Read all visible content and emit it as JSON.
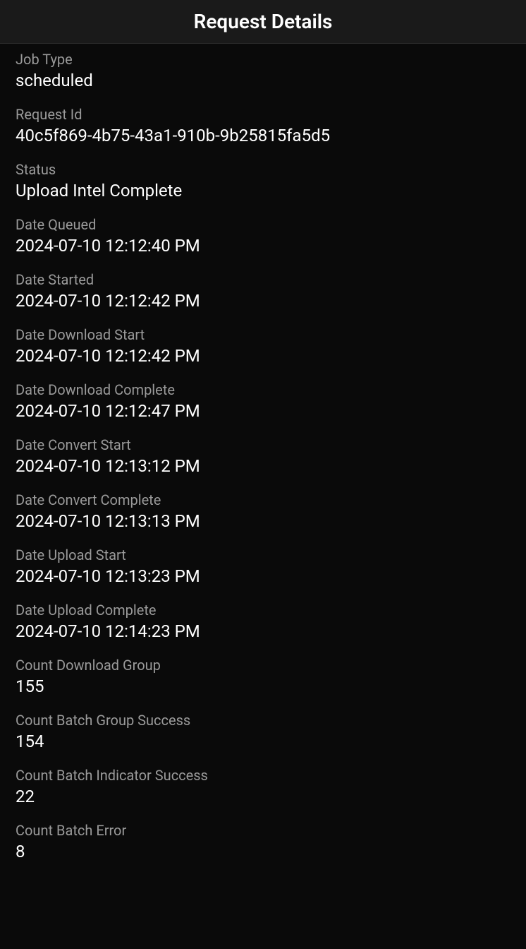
{
  "header": {
    "title": "Request Details"
  },
  "fields": [
    {
      "label": "Job Type",
      "value": "scheduled"
    },
    {
      "label": "Request Id",
      "value": "40c5f869-4b75-43a1-910b-9b25815fa5d5"
    },
    {
      "label": "Status",
      "value": "Upload Intel Complete"
    },
    {
      "label": "Date Queued",
      "value": "2024-07-10 12:12:40 PM"
    },
    {
      "label": "Date Started",
      "value": "2024-07-10 12:12:42 PM"
    },
    {
      "label": "Date Download Start",
      "value": "2024-07-10 12:12:42 PM"
    },
    {
      "label": "Date Download Complete",
      "value": "2024-07-10 12:12:47 PM"
    },
    {
      "label": "Date Convert Start",
      "value": "2024-07-10 12:13:12 PM"
    },
    {
      "label": "Date Convert Complete",
      "value": "2024-07-10 12:13:13 PM"
    },
    {
      "label": "Date Upload Start",
      "value": "2024-07-10 12:13:23 PM"
    },
    {
      "label": "Date Upload Complete",
      "value": "2024-07-10 12:14:23 PM"
    },
    {
      "label": "Count Download Group",
      "value": "155"
    },
    {
      "label": "Count Batch Group Success",
      "value": "154"
    },
    {
      "label": "Count Batch Indicator Success",
      "value": "22"
    },
    {
      "label": "Count Batch Error",
      "value": "8"
    }
  ]
}
